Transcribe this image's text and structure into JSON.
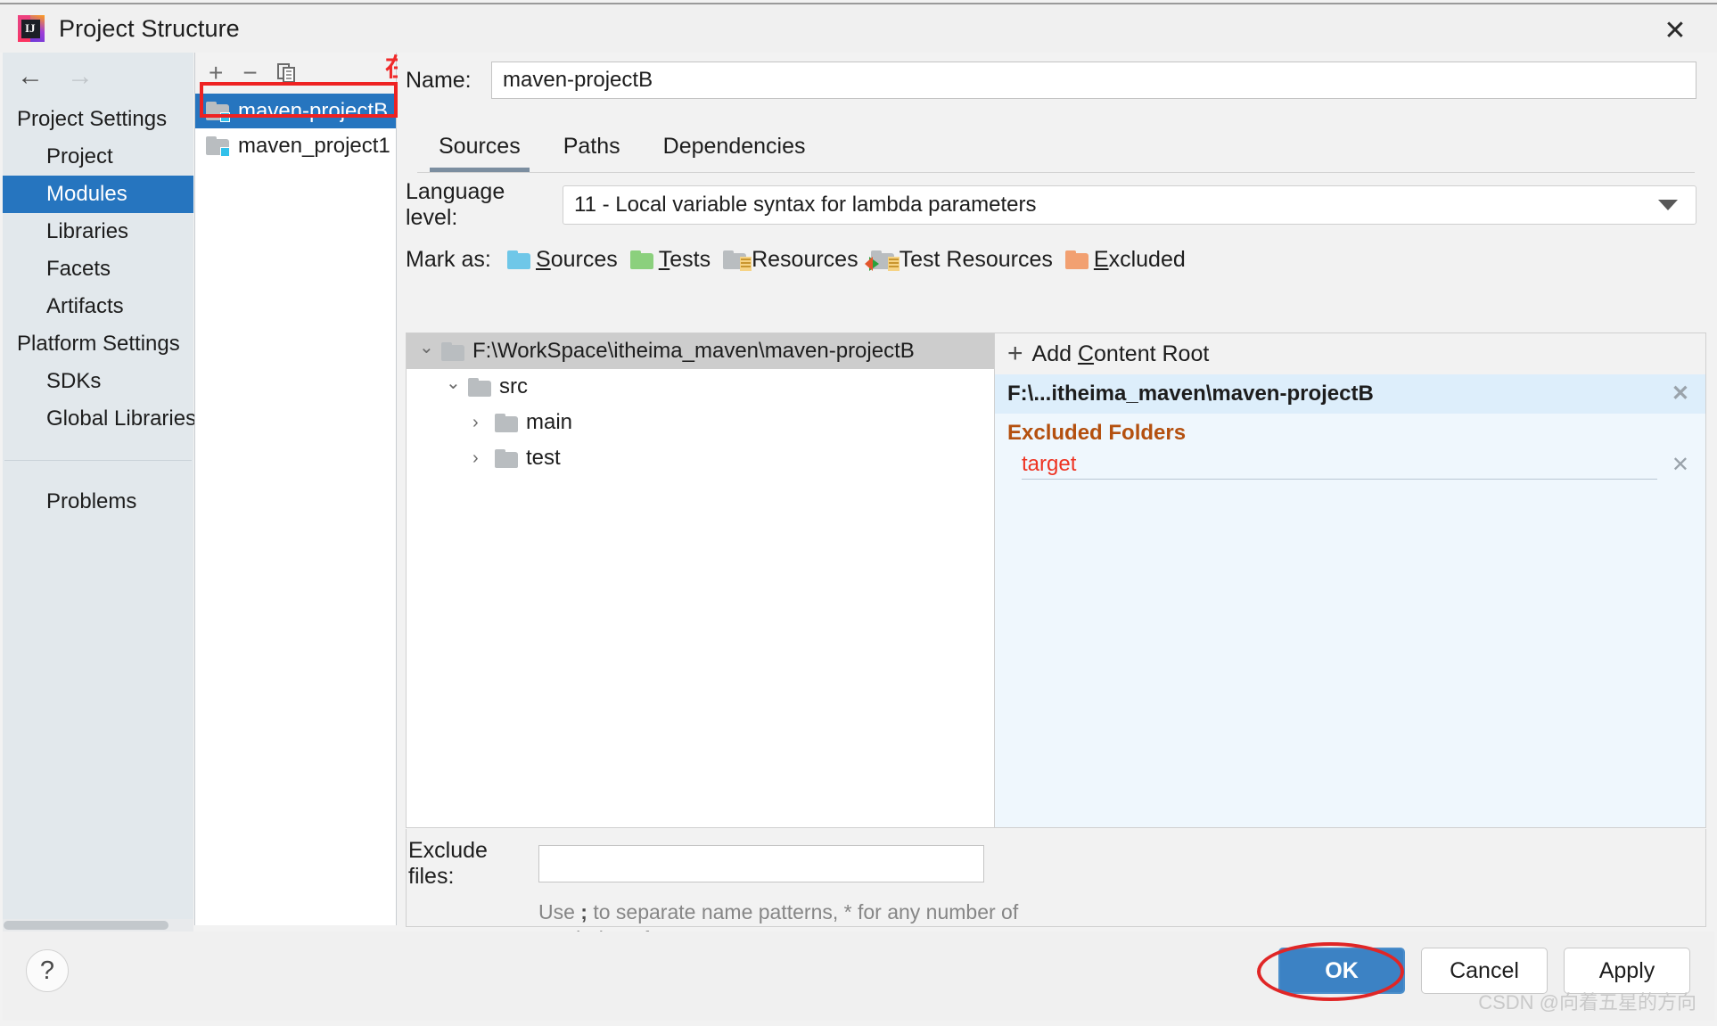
{
  "window": {
    "title": "Project Structure",
    "app_icon": "intellij-idea-icon",
    "close_label": "✕"
  },
  "sidebar": {
    "nav": {
      "back": "←",
      "forward": "→"
    },
    "groups": [
      {
        "label": "Project Settings",
        "items": [
          "Project",
          "Modules",
          "Libraries",
          "Facets",
          "Artifacts"
        ]
      },
      {
        "label": "Platform Settings",
        "items": [
          "SDKs",
          "Global Libraries"
        ]
      }
    ],
    "extra_items": [
      "Problems"
    ],
    "selected": "Modules"
  },
  "module_list": {
    "toolbar": {
      "add": "+",
      "remove": "−",
      "copy": "copy-icon"
    },
    "items": [
      "maven-projectB",
      "maven_project1"
    ],
    "selected": "maven-projectB"
  },
  "annotation": {
    "text": "在这里能够看到要导入的maven模块项目",
    "color": "#f02a2a"
  },
  "main": {
    "name_label": "Name:",
    "name_value": "maven-projectB",
    "tabs": [
      {
        "label": "Sources",
        "active": true
      },
      {
        "label": "Paths",
        "active": false
      },
      {
        "label": "Dependencies",
        "active": false
      }
    ],
    "language_level": {
      "label": "Language level:",
      "value": "11 - Local variable syntax for lambda parameters"
    },
    "mark_as": {
      "label": "Mark as:",
      "options": [
        {
          "label": "Sources",
          "accesskey": "S",
          "icon": "folder-blue-icon"
        },
        {
          "label": "Tests",
          "accesskey": "T",
          "icon": "folder-green-icon"
        },
        {
          "label": "Resources",
          "accesskey": "",
          "icon": "folder-resources-icon"
        },
        {
          "label": "Test Resources",
          "accesskey": "",
          "icon": "folder-test-resources-icon"
        },
        {
          "label": "Excluded",
          "accesskey": "E",
          "icon": "folder-orange-icon"
        }
      ]
    },
    "tree": [
      {
        "label": "F:\\WorkSpace\\itheima_maven\\maven-projectB",
        "level": 0,
        "expanded": true
      },
      {
        "label": "src",
        "level": 1,
        "expanded": true
      },
      {
        "label": "main",
        "level": 2,
        "expanded": false
      },
      {
        "label": "test",
        "level": 2,
        "expanded": false
      }
    ],
    "right_panel": {
      "add_content_root": "Add Content Root",
      "content_root": "F:\\...itheima_maven\\maven-projectB",
      "excluded_title": "Excluded Folders",
      "excluded_items": [
        "target"
      ],
      "remove_glyph": "✕"
    },
    "exclude_files": {
      "label": "Exclude files:",
      "value": "",
      "hint_line1_a": "Use ",
      "hint_line1_b": ";",
      "hint_line1_c": " to separate name patterns, * for any number of",
      "hint_line2_a": "symbols, ",
      "hint_line2_b": "?",
      "hint_line2_c": " for one."
    }
  },
  "footer": {
    "help": "?",
    "buttons": [
      {
        "label": "OK",
        "style": "primary"
      },
      {
        "label": "Cancel",
        "style": "secondary"
      },
      {
        "label": "Apply",
        "style": "secondary"
      }
    ],
    "watermark": "CSDN @向着五星的方向"
  },
  "colors": {
    "selection_blue": "#2675bf",
    "annotation_red": "#ee2222",
    "primary_button": "#3c82c4",
    "excluded_title": "#b4500f",
    "excluded_item": "#ee3322"
  }
}
